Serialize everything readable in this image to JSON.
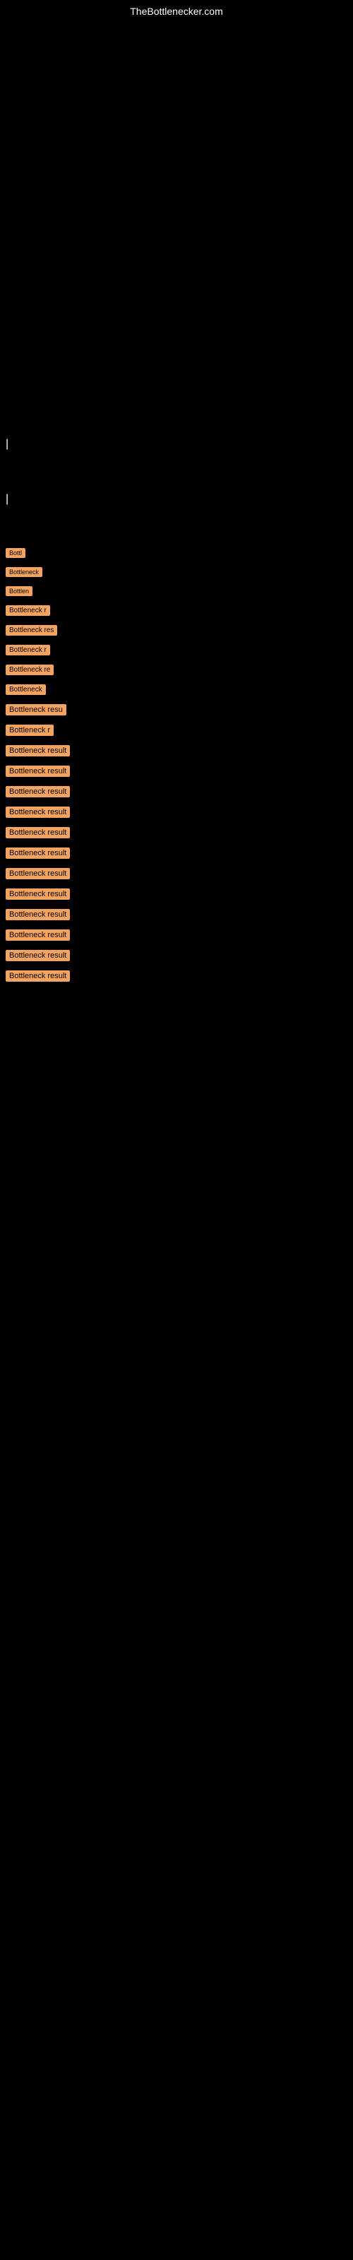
{
  "site": {
    "title": "TheBottlenecker.com"
  },
  "cursors": {
    "line1": "|",
    "line2": "|"
  },
  "bottleneck_items": [
    {
      "id": 1,
      "label": "Bottleneck result",
      "badge_class": "badge-w1",
      "display": "Bottl"
    },
    {
      "id": 2,
      "label": "Bottleneck result",
      "badge_class": "badge-w2",
      "display": "Bottleneck"
    },
    {
      "id": 3,
      "label": "Bottleneck result",
      "badge_class": "badge-w3",
      "display": "Bottlen"
    },
    {
      "id": 4,
      "label": "Bottleneck result",
      "badge_class": "badge-w4",
      "display": "Bottleneck r"
    },
    {
      "id": 5,
      "label": "Bottleneck result",
      "badge_class": "badge-w5",
      "display": "Bottleneck res"
    },
    {
      "id": 6,
      "label": "Bottleneck result",
      "badge_class": "badge-w6",
      "display": "Bottleneck r"
    },
    {
      "id": 7,
      "label": "Bottleneck result",
      "badge_class": "badge-w7",
      "display": "Bottleneck re"
    },
    {
      "id": 8,
      "label": "Bottleneck result",
      "badge_class": "badge-w8",
      "display": "Bottleneck"
    },
    {
      "id": 9,
      "label": "Bottleneck result",
      "badge_class": "badge-w9",
      "display": "Bottleneck resu"
    },
    {
      "id": 10,
      "label": "Bottleneck result",
      "badge_class": "badge-w10",
      "display": "Bottleneck r"
    },
    {
      "id": 11,
      "label": "Bottleneck result",
      "badge_class": "badge-w11",
      "display": "Bottleneck result"
    },
    {
      "id": 12,
      "label": "Bottleneck result",
      "badge_class": "badge-w12",
      "display": "Bottleneck result"
    },
    {
      "id": 13,
      "label": "Bottleneck result",
      "badge_class": "badge-w13",
      "display": "Bottleneck result"
    },
    {
      "id": 14,
      "label": "Bottleneck result",
      "badge_class": "badge-w14",
      "display": "Bottleneck result"
    },
    {
      "id": 15,
      "label": "Bottleneck result",
      "badge_class": "badge-w15",
      "display": "Bottleneck result"
    },
    {
      "id": 16,
      "label": "Bottleneck result",
      "badge_class": "badge-w16",
      "display": "Bottleneck result"
    },
    {
      "id": 17,
      "label": "Bottleneck result",
      "badge_class": "badge-w17",
      "display": "Bottleneck result"
    },
    {
      "id": 18,
      "label": "Bottleneck result",
      "badge_class": "badge-w18",
      "display": "Bottleneck result"
    },
    {
      "id": 19,
      "label": "Bottleneck result",
      "badge_class": "badge-w19",
      "display": "Bottleneck result"
    },
    {
      "id": 20,
      "label": "Bottleneck result",
      "badge_class": "badge-w20",
      "display": "Bottleneck result"
    },
    {
      "id": 21,
      "label": "Bottleneck result",
      "badge_class": "badge-w21",
      "display": "Bottleneck result"
    },
    {
      "id": 22,
      "label": "Bottleneck result",
      "badge_class": "badge-w22",
      "display": "Bottleneck result"
    }
  ]
}
